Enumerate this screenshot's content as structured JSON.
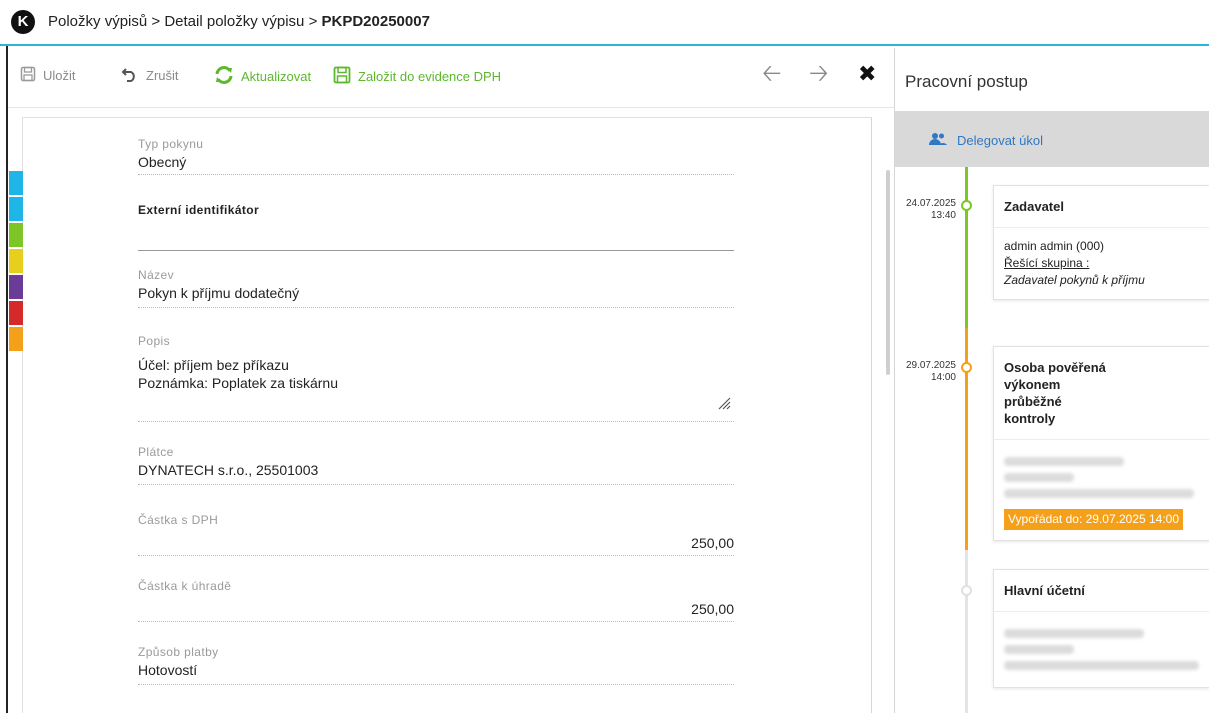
{
  "titlebar": {
    "logo_glyph": "K",
    "crumb_1": "Položky výpisů",
    "separator": ">",
    "crumb_2": "Detail položky výpisu",
    "crumb_current": "PKPD20250007"
  },
  "toolbar": {
    "save_label": "Uložit",
    "cancel_label": "Zrušit",
    "refresh_label": "Aktualizovat",
    "vat_label": "Založit do evidence DPH",
    "prev_icon": "arrow-left-icon",
    "next_icon": "arrow-right-icon",
    "close_icon": "close-icon"
  },
  "colors": {
    "accent_green": "#5cb82c",
    "link_blue": "#2f78c4",
    "orange": "#f5a01a",
    "color_bars": [
      "#1fb5e6",
      "#1fb5e6",
      "#7ec528",
      "#7ec528",
      "#e8cf1e",
      "#6a3c98",
      "#d42a2a",
      "#f5a01a"
    ]
  },
  "form": {
    "typ_pokynu_label": "Typ pokynu",
    "typ_pokynu_value": "Obecný",
    "externi_label": "Externí identifikátor",
    "externi_value": "",
    "nazev_label": "Název",
    "nazev_value": "Pokyn k příjmu dodatečný",
    "popis_label": "Popis",
    "popis_line1": "Účel: příjem bez příkazu",
    "popis_line2": "Poznámka: Poplatek za tiskárnu",
    "platce_label": "Plátce",
    "platce_value": "DYNATECH s.r.o., 25501003",
    "castka_dph_label": "Částka s DPH",
    "castka_dph_value": "250,00",
    "castka_uhrade_label": "Částka k úhradě",
    "castka_uhrade_value": "250,00",
    "zpusob_label": "Způsob platby",
    "zpusob_value": "Hotovostí"
  },
  "workflow": {
    "title": "Pracovní postup",
    "delegate_label": "Delegovat úkol",
    "steps": [
      {
        "date": "24.07.2025",
        "time": "13:40",
        "role": "Zadavatel",
        "user": "admin admin (000)",
        "group_label": "Řešící skupina :",
        "group_value": "Zadavatel pokynů k příjmu"
      },
      {
        "date": "29.07.2025",
        "time": "14:00",
        "role": "Osoba pověřená výkonem průběžné kontroly",
        "due": "Vypořádat do: 29.07.2025 14:00"
      },
      {
        "role": "Hlavní účetní"
      }
    ]
  }
}
